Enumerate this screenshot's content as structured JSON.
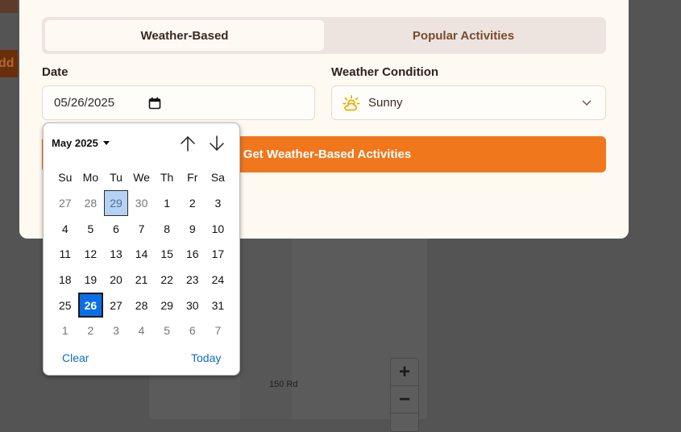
{
  "background": {
    "road_label": "150 Rd",
    "orange_button_partial": "dd",
    "zoom_in": "+",
    "zoom_out": "−"
  },
  "tabs": [
    {
      "label": "Weather-Based",
      "active": true
    },
    {
      "label": "Popular Activities",
      "active": false
    }
  ],
  "date_field": {
    "label": "Date",
    "value": "05/26/2025",
    "icon": "calendar-icon"
  },
  "weather_field": {
    "label": "Weather Condition",
    "value": "Sunny",
    "icon": "sun-cloud-icon"
  },
  "cta": {
    "label": "Get Weather-Based Activities",
    "color": "#f0771c"
  },
  "date_picker": {
    "month_label": "May 2025",
    "weekdays": [
      "Su",
      "Mo",
      "Tu",
      "We",
      "Th",
      "Fr",
      "Sa"
    ],
    "weeks": [
      [
        "27",
        "28",
        "29",
        "30",
        "1",
        "2",
        "3"
      ],
      [
        "4",
        "5",
        "6",
        "7",
        "8",
        "9",
        "10"
      ],
      [
        "11",
        "12",
        "13",
        "14",
        "15",
        "16",
        "17"
      ],
      [
        "18",
        "19",
        "20",
        "21",
        "22",
        "23",
        "24"
      ],
      [
        "25",
        "26",
        "27",
        "28",
        "29",
        "30",
        "31"
      ],
      [
        "1",
        "2",
        "3",
        "4",
        "5",
        "6",
        "7"
      ]
    ],
    "today_label": "29",
    "selected_label": "26",
    "clear_label": "Clear",
    "today_button_label": "Today",
    "selected_color": "#0a6ee8"
  }
}
